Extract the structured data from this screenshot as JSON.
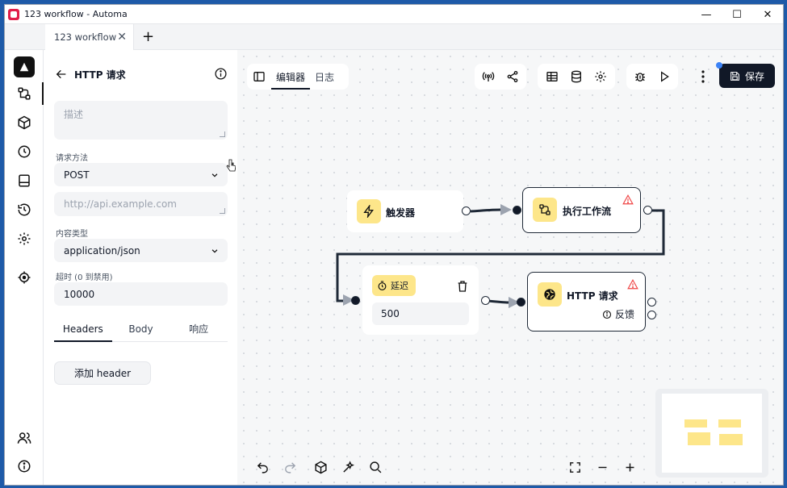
{
  "window": {
    "title": "123 workflow - Automa",
    "controls": {
      "minimize": "—",
      "maximize": "☐",
      "close": "✕"
    }
  },
  "tabs": [
    {
      "label": "123 workflow",
      "close": "✕"
    }
  ],
  "tab_add": "+",
  "rail": {
    "items": [
      "workflows-icon",
      "packages-icon",
      "schedule-icon",
      "storage-icon",
      "history-icon",
      "settings-icon",
      "recording-icon"
    ],
    "bottom": [
      "community-icon",
      "about-icon"
    ]
  },
  "panel": {
    "title": "HTTP 请求",
    "description_placeholder": "描述",
    "method_label": "请求方法",
    "method_value": "POST",
    "url_placeholder": "http://api.example.com",
    "content_type_label": "内容类型",
    "content_type_value": "application/json",
    "timeout_label": "超时 (0 到禁用)",
    "timeout_value": "10000",
    "subtabs": [
      "Headers",
      "Body",
      "响应"
    ],
    "add_header_label": "添加 header"
  },
  "canvas": {
    "top_tabs": {
      "editor": "编辑器",
      "log": "日志"
    },
    "save_label": "保存",
    "nodes": {
      "trigger": {
        "label": "触发器"
      },
      "execute_workflow": {
        "label": "执行工作流"
      },
      "delay": {
        "label": "延迟",
        "value": "500"
      },
      "http_request": {
        "label": "HTTP 请求",
        "feedback": "反馈"
      }
    }
  },
  "colors": {
    "accent_yellow": "#fde68a",
    "dark": "#111827",
    "warning": "#ef4444",
    "badge_blue": "#3b82f6"
  }
}
